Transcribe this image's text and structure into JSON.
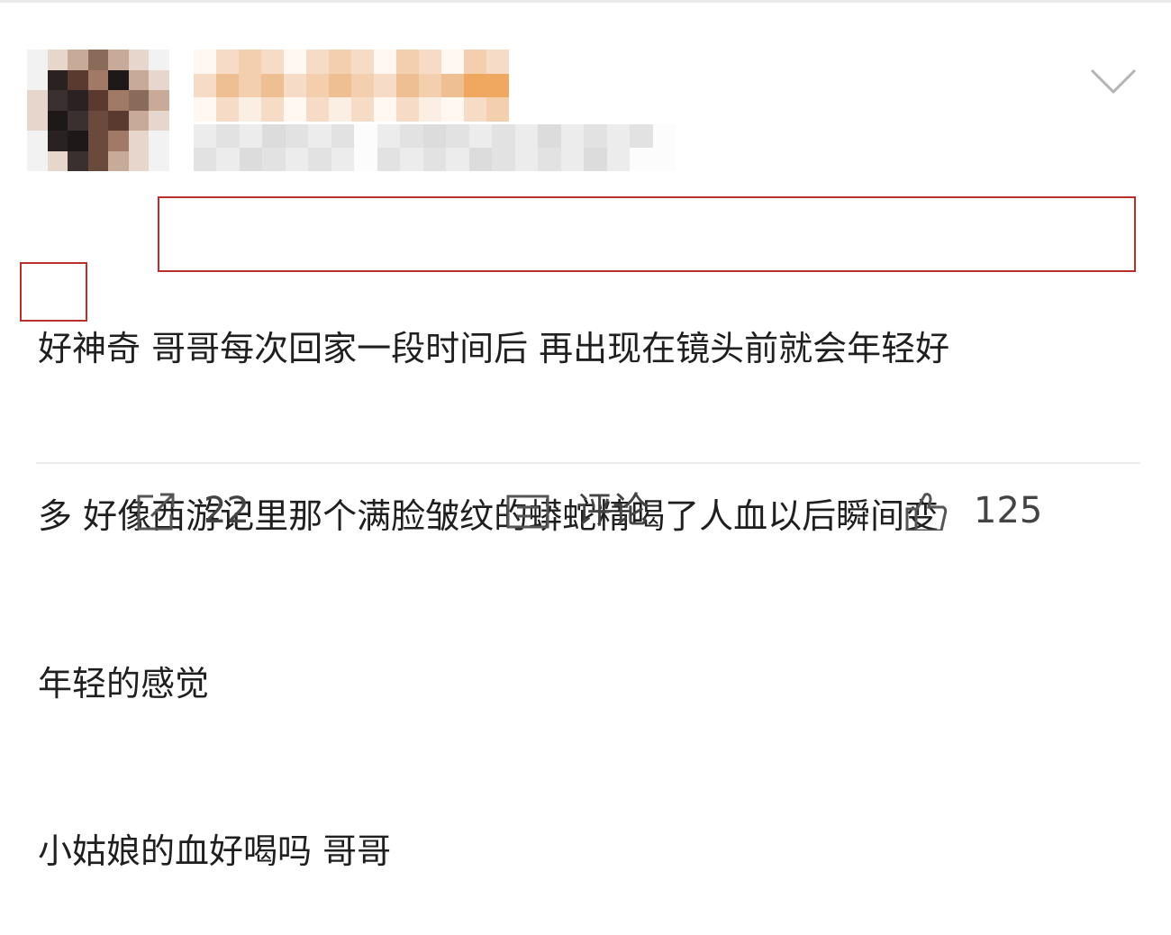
{
  "post": {
    "lines": [
      "好神奇 哥哥每次回家一段时间后 再出现在镜头前就会年轻好",
      "多 好像西游记里那个满脸皱纹的蟒蛇精喝了人血以后瞬间变",
      "年轻的感觉",
      "小姑娘的血好喝吗 哥哥"
    ]
  },
  "actions": {
    "repost": {
      "icon": "share-icon",
      "count": "22"
    },
    "comment": {
      "icon": "comment-icon",
      "label": "评论"
    },
    "like": {
      "icon": "thumbs-up-icon",
      "count": "125"
    }
  },
  "header": {
    "menu_icon": "chevron-down-icon"
  },
  "colors": {
    "highlight_box": "#b8302c",
    "text": "#1f1f1f",
    "divider": "#ececec"
  }
}
